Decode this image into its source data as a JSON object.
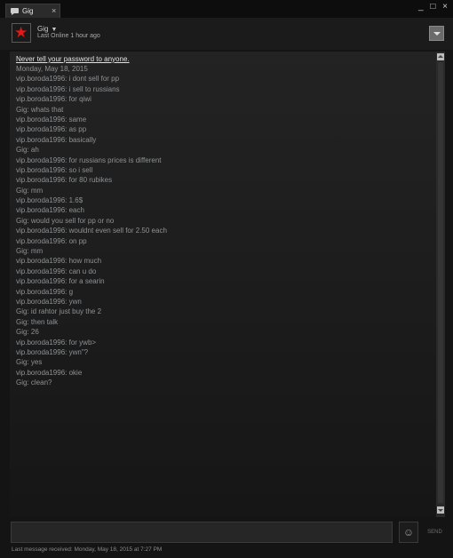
{
  "tab": {
    "label": "Gig",
    "close": "×"
  },
  "window_buttons": {
    "minimize": "_",
    "maximize": "□",
    "close": "×"
  },
  "friend": {
    "name": "Gig",
    "status": "Last Online 1 hour ago"
  },
  "chat": {
    "warning": "Never tell your password to anyone.",
    "date": "Monday, May 18, 2015",
    "messages": [
      "vip.boroda1996: i dont sell for pp",
      "vip.boroda1996: i sell to russians",
      "vip.boroda1996: for qiwi",
      "Gig: whats that",
      "vip.boroda1996: same",
      "vip.boroda1996: as pp",
      "vip.boroda1996: basically",
      "Gig: ah",
      "vip.boroda1996: for russians prices is different",
      "vip.boroda1996: so i sell",
      "vip.boroda1996: for 80 rubikes",
      "Gig: mm",
      "vip.boroda1996: 1.6$",
      "vip.boroda1996: each",
      "Gig: would you sell for pp or no",
      "vip.boroda1996: wouldnt even sell for 2.50 each",
      "vip.boroda1996: on pp",
      "Gig: mm",
      "vip.boroda1996: how much",
      "vip.boroda1996: can u do",
      "vip.boroda1996: for a searin",
      "vip.boroda1996: g",
      "vip.boroda1996: ywn",
      "Gig: id rahtor just buy the 2",
      "Gig: then talk",
      "Gig: 26",
      "vip.boroda1996: for ywb>",
      "vip.boroda1996: ywn\"?",
      "Gig: yes",
      "vip.boroda1996: okie",
      "Gig: clean?"
    ]
  },
  "entry": {
    "value": "",
    "placeholder": "",
    "emoji": "☺",
    "send_label": "SEND"
  },
  "footer": {
    "last_message": "Last message received: Monday, May 18, 2015 at 7:27 PM"
  }
}
